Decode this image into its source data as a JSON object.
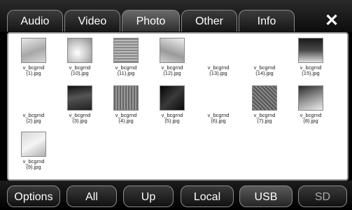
{
  "tabs": [
    {
      "label": "Audio"
    },
    {
      "label": "Video"
    },
    {
      "label": "Photo"
    },
    {
      "label": "Other"
    },
    {
      "label": "Info"
    }
  ],
  "close_label": "✕",
  "files": [
    {
      "name": "v_bcgrnd",
      "ext": "(1).jpg"
    },
    {
      "name": "v_bcgrnd",
      "ext": "(10).jpg"
    },
    {
      "name": "v_bcgrnd",
      "ext": "(11).jpg"
    },
    {
      "name": "v_bcgrnd",
      "ext": "(12).jpg"
    },
    {
      "name": "v_bcgrnd",
      "ext": "(13).jpg"
    },
    {
      "name": "v_bcgrnd",
      "ext": "(14).jpg"
    },
    {
      "name": "v_bcgrnd",
      "ext": "(15).jpg"
    },
    {
      "name": "v_bcgrnd",
      "ext": "(2).jpg"
    },
    {
      "name": "v_bcgrnd",
      "ext": "(3).jpg"
    },
    {
      "name": "v_bcgrnd",
      "ext": "(4).jpg"
    },
    {
      "name": "v_bcgrnd",
      "ext": "(5).jpg"
    },
    {
      "name": "v_bcgrnd",
      "ext": "(6).jpg"
    },
    {
      "name": "v_bcgrnd",
      "ext": "(7).jpg"
    },
    {
      "name": "v_bcgrnd",
      "ext": "(8).jpg"
    },
    {
      "name": "v_bcgrnd",
      "ext": "(9).jpg"
    }
  ],
  "buttons": [
    {
      "label": "Options"
    },
    {
      "label": "All"
    },
    {
      "label": "Up"
    },
    {
      "label": "Local"
    },
    {
      "label": "USB"
    },
    {
      "label": "SD"
    }
  ]
}
